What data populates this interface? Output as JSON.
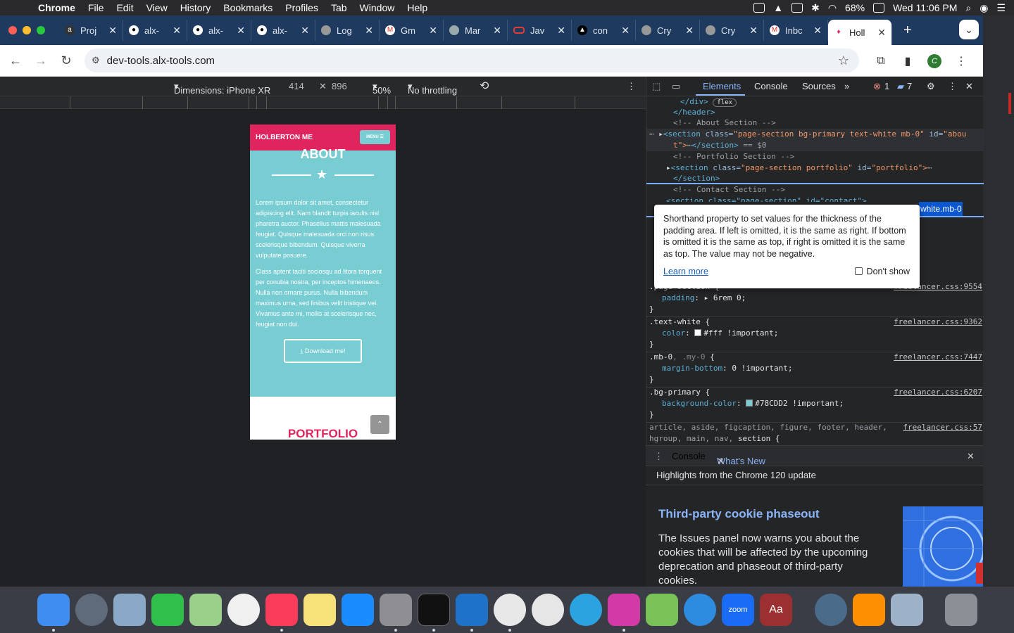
{
  "menubar": {
    "app": "Chrome",
    "items": [
      "File",
      "Edit",
      "View",
      "History",
      "Bookmarks",
      "Profiles",
      "Tab",
      "Window",
      "Help"
    ],
    "battery": "68%",
    "clock": "Wed 11:06 PM"
  },
  "tabs": [
    {
      "label": "Proj",
      "icon": "alx-icon"
    },
    {
      "label": "alx-",
      "icon": "github-icon"
    },
    {
      "label": "alx-",
      "icon": "github-icon"
    },
    {
      "label": "alx-",
      "icon": "github-icon"
    },
    {
      "label": "Log",
      "icon": "globe-icon"
    },
    {
      "label": "Gm",
      "icon": "gmail-icon"
    },
    {
      "label": "Mar",
      "icon": "site-icon"
    },
    {
      "label": "Jav",
      "icon": "oracle-icon"
    },
    {
      "label": "con",
      "icon": "site-icon"
    },
    {
      "label": "Cry",
      "icon": "globe-icon"
    },
    {
      "label": "Cry",
      "icon": "globe-icon"
    },
    {
      "label": "Inbc",
      "icon": "gmail-icon"
    },
    {
      "label": "Holl",
      "icon": "site-icon",
      "active": true
    }
  ],
  "address": {
    "url": "dev-tools.alx-tools.com",
    "profile": "C"
  },
  "device": {
    "dimensions": "Dimensions: iPhone XR",
    "width": "414",
    "height": "896",
    "zoom": "50%",
    "throttle": "No throttling"
  },
  "phone": {
    "brand": "HOLBERTON ME",
    "menu": "MENU",
    "about": "ABOUT",
    "p1": "Lorem ipsum dolor sit amet, consectetur adipiscing elit. Nam blandit turpis iaculis nisl pharetra auctor. Phasellus mattis malesuada feugiat. Quisque malesuada orci non risus scelerisque bibendum. Quisque viverra vulputate posuere.",
    "p2": "Class aptent taciti sociosqu ad litora torquent per conubia nostra, per inceptos himenaeos. Nulla non ornare purus. Nulla bibendum maximus urna, sed finibus velit tristique vel. Vivamus ante mi, mollis at scelerisque nec, feugiat non dui.",
    "download": "Download me!",
    "portfolio": "PORTFOLIO"
  },
  "devtools": {
    "tabs": [
      "Elements",
      "Console",
      "Sources"
    ],
    "errors": "1",
    "messages": "7",
    "dom": {
      "l1_tag": "</div>",
      "l1_badge": "flex",
      "l2": "</header>",
      "l3": "<!-- About Section -->",
      "l4a": "<section ",
      "l4b": "class=",
      "l4c": "\"page-section bg-primary text-white mb-0\"",
      "l4d": " id=",
      "l4e": "\"abou",
      "l5a": "t\">",
      "l5b": "</section>",
      "l5c": " == $0",
      "l6": "<!-- Portfolio Section -->",
      "l7a": "<section ",
      "l7b": "class=",
      "l7c": "\"page-section portfolio\"",
      "l7d": " id=",
      "l7e": "\"portfolio\">",
      "l8": "</section>",
      "l9": "<!-- Contact Section -->",
      "l10": "<section class=\"page-section\" id=\"contact\">"
    },
    "breadcrumb": "white.mb-0",
    "tooltip": {
      "text": "Shorthand property to set values for the thickness of the padding area. If left is omitted, it is the same as right. If bottom is omitted it is the same as top, if right is omitted it is the same as top. The value may not be negative.",
      "link": "Learn more",
      "checkbox": "Don't show"
    },
    "rules": [
      {
        "sel": ".page-section {",
        "prop": "padding",
        "val": "6rem 0;",
        "src": "freelancer.css:9554"
      },
      {
        "sel": ".text-white {",
        "prop": "color",
        "val": "#fff !important;",
        "src": "freelancer.css:9362"
      },
      {
        "sel": ".mb-0",
        "sel2": ", .my-0",
        "sel3": " {",
        "prop": "margin-bottom",
        "val": "0 !important;",
        "src": "freelancer.css:7447"
      },
      {
        "sel": ".bg-primary {",
        "prop": "background-color",
        "val": "#78CDD2 !important;",
        "src": "freelancer.css:6207"
      },
      {
        "sel": "article, aside, figcaption, figure, footer, header,",
        "sel2": "hgroup, main, nav,",
        "sel3": " section {",
        "src": "freelancer.css:57"
      }
    ],
    "close": "}"
  },
  "drawer": {
    "tabs": [
      "Console",
      "What's New"
    ],
    "highlights": "Highlights from the Chrome 120 update",
    "title": "Third-party cookie phaseout",
    "body": "The Issues panel now warns you about the cookies that will be affected by the upcoming deprecation and phaseout of third-party cookies."
  },
  "colors": {
    "brand": "#e0245e",
    "teal": "#78cdd2",
    "link": "#8ab4f8"
  }
}
